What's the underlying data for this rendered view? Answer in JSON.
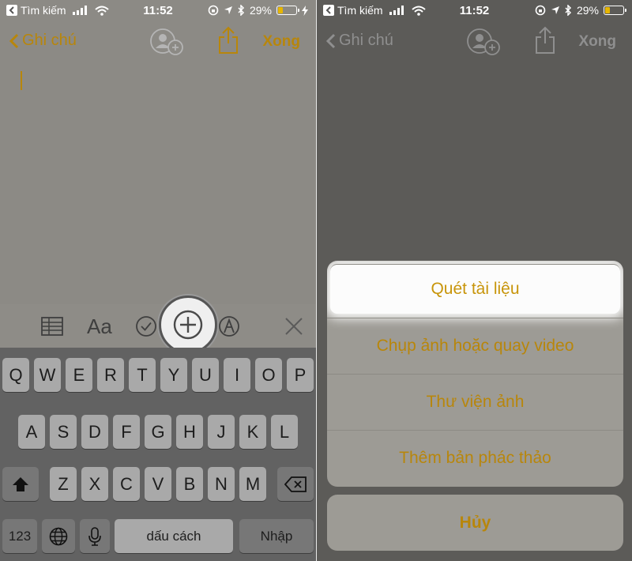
{
  "status": {
    "back_app": "Tìm kiếm",
    "time": "11:52",
    "battery": "29%",
    "battery_level": 0.29
  },
  "nav": {
    "back_label": "Ghi chú",
    "done_label": "Xong",
    "icons": [
      "add-people-icon",
      "share-icon"
    ]
  },
  "toolbar": {
    "format_label": "Aa",
    "icons": [
      "table-icon",
      "checklist-icon",
      "plus-circle-icon",
      "markup-icon",
      "close-icon"
    ]
  },
  "keyboard": {
    "row1": [
      "Q",
      "W",
      "E",
      "R",
      "T",
      "Y",
      "U",
      "I",
      "O",
      "P"
    ],
    "row2": [
      "A",
      "S",
      "D",
      "F",
      "G",
      "H",
      "J",
      "K",
      "L"
    ],
    "row3": [
      "Z",
      "X",
      "C",
      "V",
      "B",
      "N",
      "M"
    ],
    "numbers": "123",
    "space": "dấu cách",
    "return": "Nhập"
  },
  "sheet": {
    "items": [
      "Quét tài liệu",
      "Chụp ảnh hoặc quay video",
      "Thư viện ảnh",
      "Thêm bản phác thảo"
    ],
    "cancel": "Hủy"
  },
  "colors": {
    "accent": "#b8860b",
    "highlight_bg": "#fcfcfc"
  }
}
